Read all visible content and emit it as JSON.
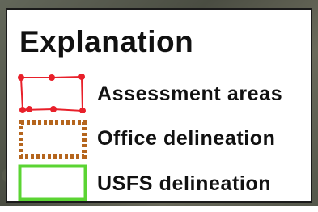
{
  "legend": {
    "title": "Explanation",
    "items": [
      {
        "label": "Assessment areas",
        "symbol": "red-outline-with-vertex-dots",
        "color": "#e8202a"
      },
      {
        "label": "Office delineation",
        "symbol": "brown-dotted-outline",
        "color": "#b5651d"
      },
      {
        "label": "USFS delineation",
        "symbol": "green-solid-outline",
        "color": "#5bd433"
      }
    ]
  }
}
